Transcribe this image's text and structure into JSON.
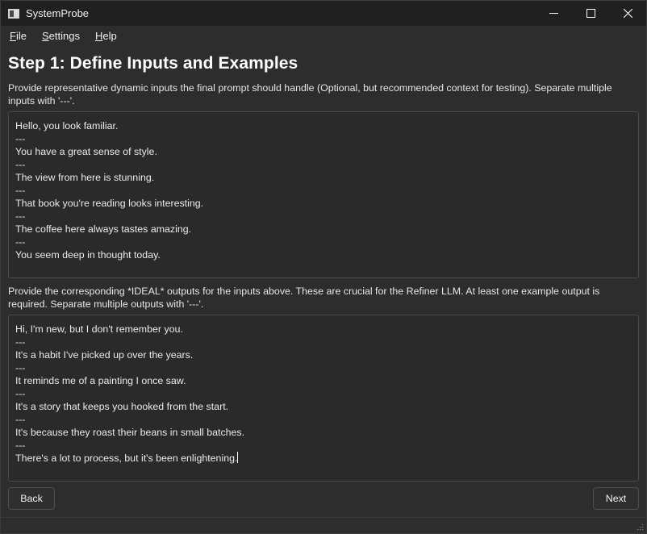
{
  "window": {
    "title": "SystemProbe"
  },
  "menu": {
    "items": [
      {
        "first": "F",
        "rest": "ile"
      },
      {
        "first": "S",
        "rest": "ettings"
      },
      {
        "first": "H",
        "rest": "elp"
      }
    ]
  },
  "main": {
    "heading": "Step 1: Define Inputs and Examples",
    "inputs_description": "Provide representative dynamic inputs the final prompt should handle (Optional, but recommended context for testing). Separate multiple inputs with '---'.",
    "inputs_value": "Hello, you look familiar.\n---\nYou have a great sense of style.\n---\nThe view from here is stunning.\n---\nThat book you're reading looks interesting.\n---\nThe coffee here always tastes amazing.\n---\nYou seem deep in thought today.",
    "outputs_description": "Provide the corresponding *IDEAL* outputs for the inputs above. These are crucial for the Refiner LLM. At least one example output is required. Separate multiple outputs with '---'.",
    "outputs_value": "Hi, I'm new, but I don't remember you.\n---\nIt's a habit I've picked up over the years.\n---\nIt reminds me of a painting I once saw.\n---\nIt's a story that keeps you hooked from the start.\n---\nIt's because they roast their beans in small batches.\n---\nThere's a lot to process, but it's been enlightening."
  },
  "footer": {
    "back_label": "Back",
    "next_label": "Next"
  },
  "icons": {
    "app": "app-window-icon",
    "minimize": "minimize-icon",
    "maximize": "maximize-icon",
    "close": "close-icon",
    "resize": "resize-grip-icon"
  }
}
